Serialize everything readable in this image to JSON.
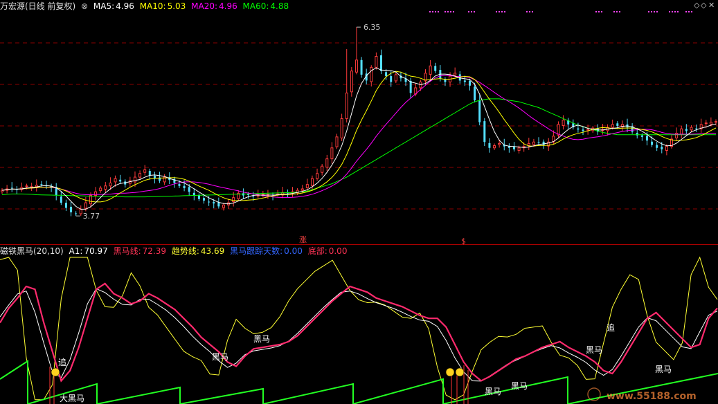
{
  "header": {
    "stock": "万宏源(日线 前复权)",
    "ma5_label": "MA5:",
    "ma5_value": "4.96",
    "ma10_label": "MA10:",
    "ma10_value": "5.03",
    "ma20_label": "MA20:",
    "ma20_value": "4.96",
    "ma60_label": "MA60:",
    "ma60_value": "4.88"
  },
  "subheader": {
    "name": "磁铁黑马(20,10)",
    "a1_label": "A1:",
    "a1_value": "70.97",
    "hm_label": "黑马线:",
    "hm_value": "72.39",
    "trend_label": "趋势线:",
    "trend_value": "43.69",
    "track_label": "黑马跟踪天数:",
    "track_value": "0.00",
    "bottom_label": "底部:",
    "bottom_value": "0.00"
  },
  "colors": {
    "up": "#ff3b3b",
    "down": "#54e0ff",
    "ma5": "#ffffff",
    "ma10": "#ffff00",
    "ma20": "#ff00ff",
    "ma60": "#00ff00",
    "a1": "#ffffff",
    "hm": "#ff2a6d",
    "trend": "#ffff33",
    "track": "#22ff22",
    "grid": "#8b0000",
    "divider": "#aa0000"
  },
  "chart_data": [
    {
      "type": "candlestick",
      "title": "万宏源(日线 前复权)",
      "annotations": {
        "high": "6.35",
        "low": "3.77"
      },
      "markers": [
        "涨",
        "$"
      ],
      "series": [
        {
          "name": "MA5",
          "last": 4.96
        },
        {
          "name": "MA10",
          "last": 5.03
        },
        {
          "name": "MA20",
          "last": 4.96
        },
        {
          "name": "MA60",
          "last": 4.88
        }
      ],
      "close": [
        4.12,
        4.14,
        4.15,
        4.13,
        4.16,
        4.18,
        4.17,
        4.19,
        4.2,
        4.18,
        4.15,
        4.05,
        3.95,
        3.88,
        3.82,
        3.8,
        3.86,
        3.95,
        4.05,
        4.1,
        4.15,
        4.18,
        4.22,
        4.28,
        4.24,
        4.2,
        4.25,
        4.3,
        4.35,
        4.4,
        4.32,
        4.28,
        4.25,
        4.3,
        4.26,
        4.22,
        4.18,
        4.15,
        4.1,
        4.05,
        4,
        3.98,
        3.96,
        3.94,
        3.9,
        3.92,
        3.95,
        4.02,
        4.08,
        4.05,
        4.06,
        4.04,
        4.05,
        4.07,
        4.06,
        4.05,
        4.07,
        4.09,
        4.08,
        4.1,
        4.12,
        4.14,
        4.2,
        4.28,
        4.35,
        4.45,
        4.55,
        4.7,
        4.85,
        5.1,
        5.45,
        5.75,
        5.9,
        5.7,
        5.62,
        5.8,
        5.95,
        5.75,
        5.68,
        5.6,
        5.7,
        5.65,
        5.6,
        5.45,
        5.52,
        5.6,
        5.72,
        5.82,
        5.75,
        5.65,
        5.6,
        5.68,
        5.72,
        5.62,
        5.6,
        5.55,
        5.35,
        5.05,
        4.78,
        4.7,
        4.73,
        4.76,
        4.72,
        4.7,
        4.68,
        4.7,
        4.72,
        4.76,
        4.78,
        4.77,
        4.74,
        4.78,
        4.86,
        5.02,
        5.08,
        5.02,
        4.98,
        4.95,
        4.93,
        4.95,
        4.97,
        4.92,
        4.95,
        4.98,
        5.02,
        5,
        5.02,
        4.98,
        4.92,
        4.87,
        4.85,
        4.8,
        4.74,
        4.7,
        4.68,
        4.72,
        4.82,
        4.9,
        4.96,
        4.93,
        4.98,
        4.96,
        5.02,
        5.04,
        5.05,
        5.06
      ],
      "ma60": [
        4.06,
        4.065,
        4.07,
        4.07,
        4.07,
        4.068,
        4.065,
        4.06,
        4.058,
        4.056,
        4.055,
        4.053,
        4.052,
        4.05,
        4.048,
        4.046,
        4.045,
        4.043,
        4.042,
        4.04,
        4.038,
        4.036,
        4.035,
        4.034,
        4.032,
        4.03,
        4.03,
        4.03,
        4.03,
        4.03,
        4.032,
        4.034,
        4.036,
        4.038,
        4.04,
        4.042,
        4.044,
        4.046,
        4.048,
        4.05,
        4.052,
        4.054,
        4.056,
        4.058,
        4.06,
        4.062,
        4.064,
        4.066,
        4.068,
        4.07,
        4.072,
        4.074,
        4.076,
        4.078,
        4.08,
        4.082,
        4.084,
        4.086,
        4.088,
        4.09,
        4.095,
        4.1,
        4.11,
        4.13,
        4.15,
        4.17,
        4.19,
        4.21,
        4.24,
        4.27,
        4.3,
        4.34,
        4.38,
        4.42,
        4.46,
        4.5,
        4.54,
        4.58,
        4.62,
        4.66,
        4.7,
        4.74,
        4.78,
        4.82,
        4.86,
        4.9,
        4.94,
        4.98,
        5.02,
        5.06,
        5.1,
        5.14,
        5.18,
        5.22,
        5.26,
        5.3,
        5.33,
        5.35,
        5.36,
        5.37,
        5.37,
        5.37,
        5.36,
        5.35,
        5.34,
        5.33,
        5.31,
        5.29,
        5.27,
        5.25,
        5.22,
        5.19,
        5.16,
        5.13,
        5.1,
        5.07,
        5.04,
        5.01,
        4.99,
        4.97,
        4.95,
        4.93,
        4.91,
        4.9,
        4.89,
        4.88,
        4.88,
        4.88,
        4.88,
        4.88,
        4.88,
        4.88,
        4.88,
        4.88,
        4.88,
        4.88,
        4.88,
        4.88,
        4.88,
        4.88,
        4.88,
        4.88,
        4.88,
        4.88,
        4.88,
        4.88
      ]
    },
    {
      "type": "line",
      "title": "磁铁黑马(20,10)",
      "ylim": [
        0,
        100
      ],
      "labels": [
        "追",
        "大黑马",
        "黑马",
        "黑马",
        "黑马",
        "黑马",
        "黑马",
        "追",
        "黑马"
      ],
      "series": [
        {
          "name": "A1",
          "last": 70.97
        },
        {
          "name": "黑马线",
          "last": 72.39,
          "values": [
            55,
            65,
            72,
            80,
            78,
            55,
            35,
            15,
            22,
            38,
            58,
            78,
            82,
            75,
            72,
            68,
            70,
            75,
            72,
            68,
            64,
            58,
            52,
            45,
            40,
            35,
            28,
            25,
            32,
            37,
            38,
            39,
            40,
            42,
            46,
            52,
            58,
            64,
            70,
            75,
            80,
            78,
            76,
            72,
            70,
            68,
            66,
            63,
            60,
            58,
            58,
            52,
            40,
            28,
            20,
            15,
            18,
            22,
            26,
            30,
            32,
            35,
            38,
            40,
            42,
            38,
            35,
            32,
            28,
            22,
            20,
            28,
            38,
            48,
            58,
            62,
            56,
            50,
            44,
            38,
            40,
            58,
            65
          ]
        },
        {
          "name": "趋势线",
          "last": 43.69
        },
        {
          "name": "黑马跟踪天数",
          "last": 0.0
        },
        {
          "name": "底部",
          "last": 0.0
        }
      ]
    }
  ],
  "watermark": "www.55188.com"
}
